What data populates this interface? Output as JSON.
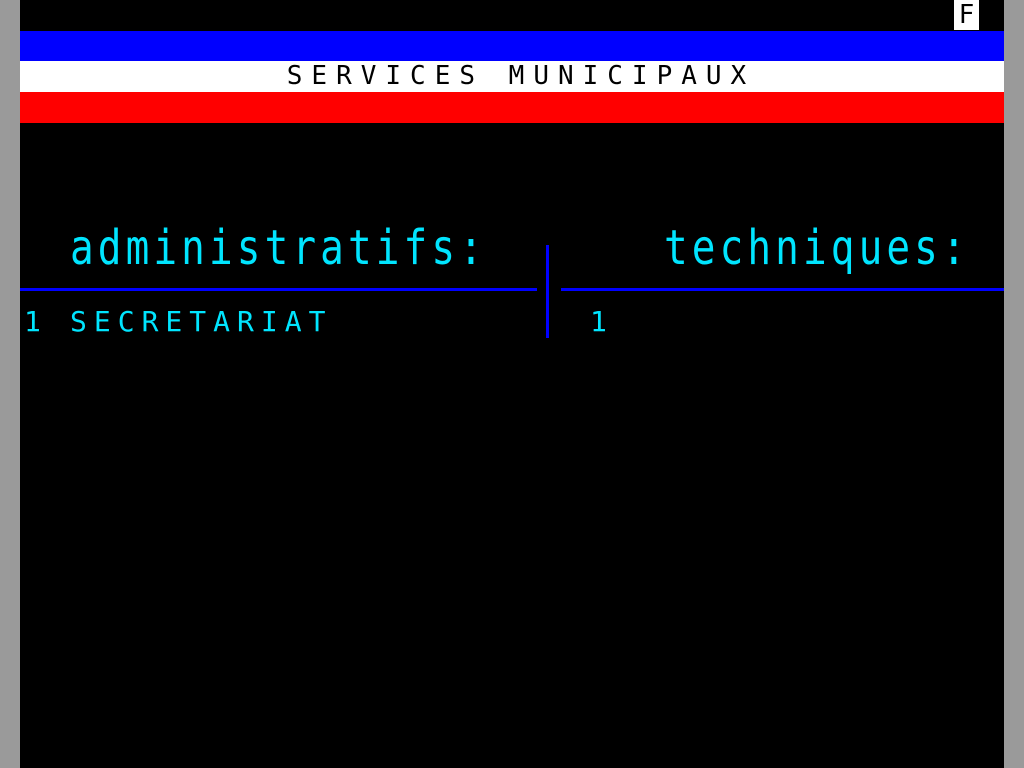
{
  "status_indicator": "F",
  "header": {
    "title": "SERVICES MUNICIPAUX",
    "flag_colors": [
      "#0000ff",
      "#ffffff",
      "#ff0000"
    ]
  },
  "columns": {
    "administratifs": {
      "heading": "administratifs:",
      "items": [
        {
          "number": "1",
          "label": "SECRETARIAT"
        }
      ]
    },
    "techniques": {
      "heading": "techniques:",
      "items": [
        {
          "number": "1",
          "label": ""
        }
      ]
    }
  },
  "colors": {
    "text": "#00e5ff",
    "rules": "#0000ff",
    "background": "#000000"
  }
}
